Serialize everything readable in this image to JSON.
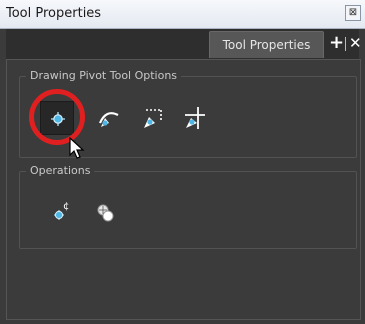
{
  "window": {
    "title": "Tool Properties",
    "close_glyph": "⊠"
  },
  "tabs": {
    "active_label": "Tool Properties",
    "add_glyph": "+",
    "close_glyph": "✕"
  },
  "sections": {
    "drawing_pivot": {
      "title": "Drawing Pivot Tool Options",
      "tools": [
        {
          "name": "set-pivot-on-drawing-icon",
          "active": true
        },
        {
          "name": "set-pivot-on-stroke-icon",
          "active": false
        },
        {
          "name": "set-pivot-on-bounding-box-icon",
          "active": false
        },
        {
          "name": "set-pivot-on-reference-icon",
          "active": false
        }
      ]
    },
    "operations": {
      "title": "Operations",
      "tools": [
        {
          "name": "reset-pivot-icon"
        },
        {
          "name": "pivot-on-center-icon"
        }
      ]
    }
  },
  "colors": {
    "highlight": "#e02020",
    "panel": "#3b3b3b",
    "icon_blue": "#4fb7e6"
  }
}
